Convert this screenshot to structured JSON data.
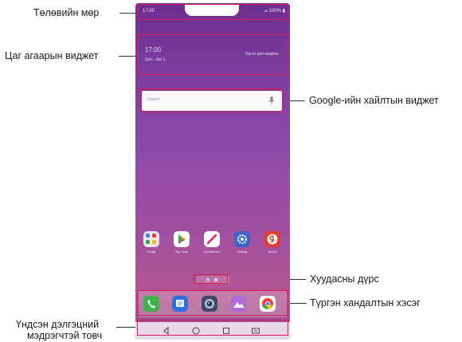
{
  "labels": {
    "status_bar": "Төлөвийн мөр",
    "weather_widget": "Цаг агаарын виджет",
    "google_search_widget": "Google-ийн хайлтын виджет",
    "page_icon": "Хуудасны дүрс",
    "quick_access": "Түргэн хандалтын хэсэг",
    "home_touch_line1": "Үндсэн дэлгэцний",
    "home_touch_line2": "мэдрэгчтэй товч"
  },
  "phone": {
    "status": {
      "time": "17:00",
      "right": "⊿ 100% ▮"
    },
    "weather": {
      "time": "17:00",
      "date": "Sun., Jan 1",
      "tap": "Tap to add weather"
    },
    "search": {
      "placeholder": "Search"
    },
    "apps": [
      {
        "name": "Google",
        "icon": "google-folder-icon"
      },
      {
        "name": "Play Store",
        "icon": "play-store-icon"
      },
      {
        "name": "QuickMemo+",
        "icon": "quickmemo-icon"
      },
      {
        "name": "Settings",
        "icon": "settings-icon"
      },
      {
        "name": "Yandex",
        "icon": "yandex-icon"
      }
    ],
    "dock": [
      {
        "icon": "phone-icon"
      },
      {
        "icon": "messages-icon"
      },
      {
        "icon": "camera-icon"
      },
      {
        "icon": "gallery-icon"
      },
      {
        "icon": "chrome-icon"
      }
    ],
    "nav": [
      "back-icon",
      "home-icon",
      "recents-icon",
      "dual-window-icon"
    ]
  },
  "colors": {
    "highlight": "#e0195a",
    "accent_purple": "#7b3b9e"
  }
}
